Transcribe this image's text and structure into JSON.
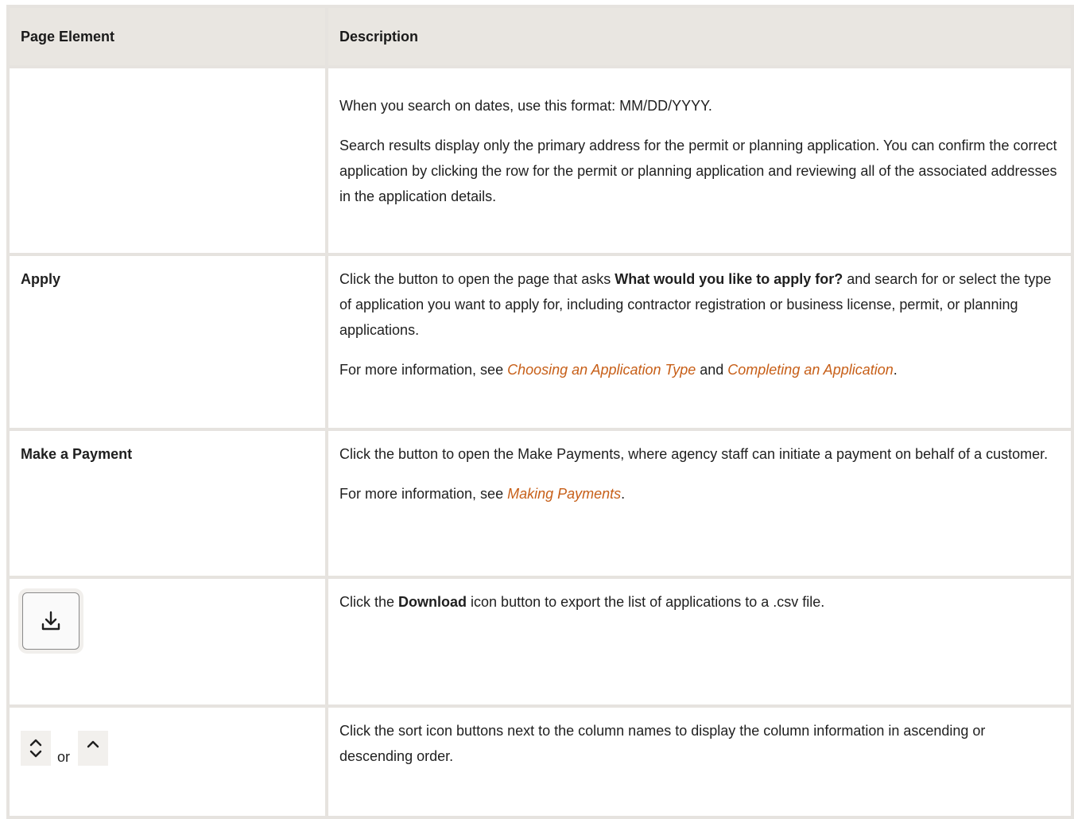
{
  "table": {
    "headers": {
      "element": "Page Element",
      "description": "Description"
    },
    "rows": [
      {
        "element": "",
        "paragraphs": [
          "When you search on dates, use this format: MM/DD/YYYY.",
          "Search results display only the primary address for the permit or planning application. You can confirm the correct application by clicking the row for the permit or planning application and reviewing all of the associated addresses in the application details."
        ]
      },
      {
        "element": "Apply",
        "p1_before": "Click the button to open the page that asks ",
        "p1_bold": "What would you like to apply for?",
        "p1_after": " and search for or select the type of application you want to apply for, including contractor registration or business license, permit, or planning applications.",
        "p2_before": "For more information, see ",
        "p2_link1": "Choosing an Application Type",
        "p2_mid": " and ",
        "p2_link2": "Completing an Application",
        "p2_after": "."
      },
      {
        "element": "Make a Payment",
        "p1": "Click the button to open the Make Payments, where agency staff can initiate a payment on behalf of a customer.",
        "p2_before": "For more information, see ",
        "p2_link": "Making Payments",
        "p2_after": "."
      },
      {
        "element_icon": "download-icon",
        "p1_before": "Click the ",
        "p1_bold": "Download",
        "p1_after": " icon button to export the list of applications to a .csv file."
      },
      {
        "element_icons": [
          "sort-up-down-icon",
          "sort-up-icon"
        ],
        "element_or": "or",
        "p1": "Click the sort icon buttons next to the column names to display the column information in ascending or descending order."
      }
    ]
  },
  "colors": {
    "header_bg": "#e9e6e1",
    "border": "#e6e3df",
    "link": "#c75f18"
  }
}
